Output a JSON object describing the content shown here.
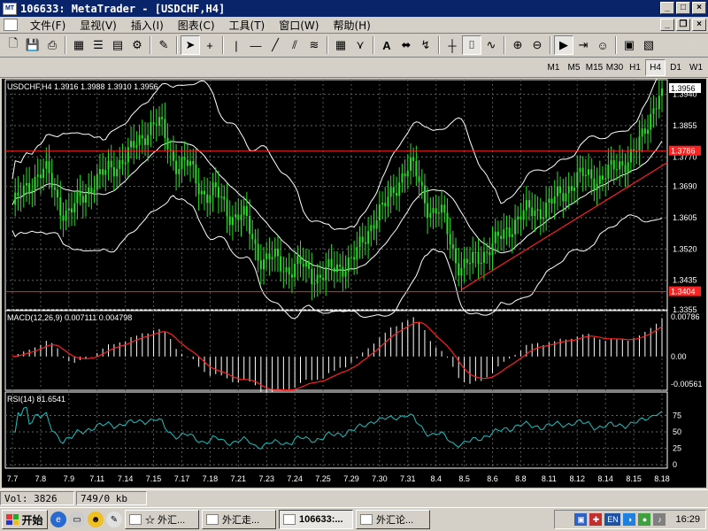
{
  "window": {
    "title": "106633: MetaTrader - [USDCHF,H4]"
  },
  "menu": [
    "文件(F)",
    "显视(V)",
    "插入(I)",
    "图表(C)",
    "工具(T)",
    "窗口(W)",
    "帮助(H)"
  ],
  "toolbar": {
    "icons": [
      "new-chart",
      "save",
      "print",
      "print-preview",
      "market-watch",
      "navigator",
      "terminal",
      "properties",
      "cursor",
      "crosshair",
      "vertical-line",
      "horizontal-line",
      "trend-line",
      "channel",
      "fibonacci",
      "gann",
      "text",
      "label",
      "arrows",
      "bar-chart",
      "candlestick",
      "line-chart",
      "zoom-in",
      "zoom-out",
      "autoscroll",
      "chart-shift",
      "expert"
    ]
  },
  "timeframes": [
    "M1",
    "M5",
    "M15",
    "M30",
    "H1",
    "H4",
    "D1",
    "W1"
  ],
  "active_timeframe": "H4",
  "chart": {
    "info_label": "USDCHF,H4  1.3916 1.3988 1.3910 1.3956",
    "price_labels": [
      "1.3940",
      "1.3855",
      "1.3770",
      "1.3690",
      "1.3605",
      "1.3520",
      "1.3435",
      "1.3355"
    ],
    "current_price": "1.3956",
    "level_high": "1.3786",
    "level_low": "1.3404",
    "colors": {
      "background": "#000000",
      "bars": "#22e022",
      "bands": "#ffffff",
      "levels": "#ff2020",
      "macd_signal": "#ff2020",
      "rsi": "#20c0c0"
    },
    "macd": {
      "label": "MACD(12,26,9)  0.007111  0.004798",
      "scale_top": "0.00786",
      "scale_mid": "0.00",
      "scale_bottom": "-0.00561"
    },
    "rsi": {
      "label": "RSI(14)  81.6541",
      "levels": [
        "75",
        "50",
        "25",
        "0"
      ]
    },
    "dates": [
      "7.7",
      "7.8",
      "7.9",
      "7.11",
      "7.14",
      "7.15",
      "7.17",
      "7.18",
      "7.21",
      "7.23",
      "7.24",
      "7.25",
      "7.29",
      "7.30",
      "7.31",
      "8.4",
      "8.5",
      "8.6",
      "8.8",
      "8.11",
      "8.12",
      "8.14",
      "8.15",
      "8.18"
    ]
  },
  "chart_data": {
    "type": "candlestick",
    "symbol": "USDCHF",
    "timeframe": "H4",
    "last_bar": {
      "open": 1.3916,
      "high": 1.3988,
      "low": 1.391,
      "close": 1.3956
    },
    "x": [
      "7.7",
      "7.8",
      "7.9",
      "7.11",
      "7.14",
      "7.15",
      "7.17",
      "7.18",
      "7.21",
      "7.23",
      "7.24",
      "7.25",
      "7.29",
      "7.30",
      "7.31",
      "8.4",
      "8.5",
      "8.6",
      "8.8",
      "8.11",
      "8.12",
      "8.14",
      "8.15",
      "8.18"
    ],
    "close": [
      1.364,
      1.373,
      1.362,
      1.371,
      1.377,
      1.386,
      1.375,
      1.367,
      1.361,
      1.349,
      1.347,
      1.345,
      1.349,
      1.362,
      1.374,
      1.362,
      1.347,
      1.353,
      1.361,
      1.364,
      1.371,
      1.372,
      1.378,
      1.395
    ],
    "ylim": [
      1.3355,
      1.398
    ],
    "horizontal_levels": [
      1.3786,
      1.3404
    ],
    "indicators": {
      "MACD(12,26,9)": {
        "main": 0.007111,
        "signal": 0.004798,
        "range": [
          -0.00561,
          0.00786
        ]
      },
      "RSI(14)": {
        "value": 81.6541,
        "levels": [
          0,
          25,
          50,
          75
        ]
      }
    }
  },
  "status": {
    "vol": "Vol: 3826",
    "traffic": "749/0 kb"
  },
  "taskbar": {
    "start": "开始",
    "tasks": [
      "☆ 外汇...",
      "外汇走...",
      "106633:...",
      "外汇论..."
    ],
    "active_task": 2,
    "clock": "16:29",
    "lang": "EN"
  }
}
